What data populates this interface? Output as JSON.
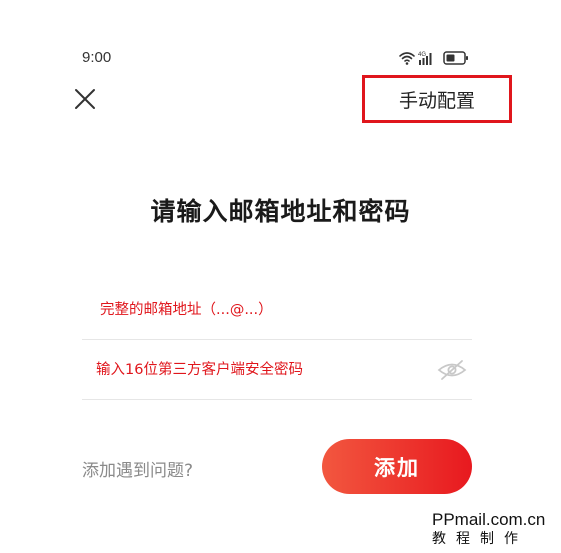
{
  "status_bar": {
    "time": "9:00",
    "network_label": "4G"
  },
  "header": {
    "close_icon": "close-icon",
    "manual_config_label": "手动配置",
    "highlight_color": "#e0161c"
  },
  "title": "请输入邮箱地址和密码",
  "form": {
    "email_placeholder": "完整的邮箱地址（...@...）",
    "email_value": "",
    "password_placeholder": "输入16位第三方客户端安全密码",
    "password_value": "",
    "password_toggle_icon": "eye-off-icon"
  },
  "footer": {
    "help_label": "添加遇到问题?",
    "add_button_label": "添加",
    "accent_color": "#e8191f"
  },
  "watermark": {
    "line1": "PPmail.com.cn",
    "line2": "教程制作"
  }
}
